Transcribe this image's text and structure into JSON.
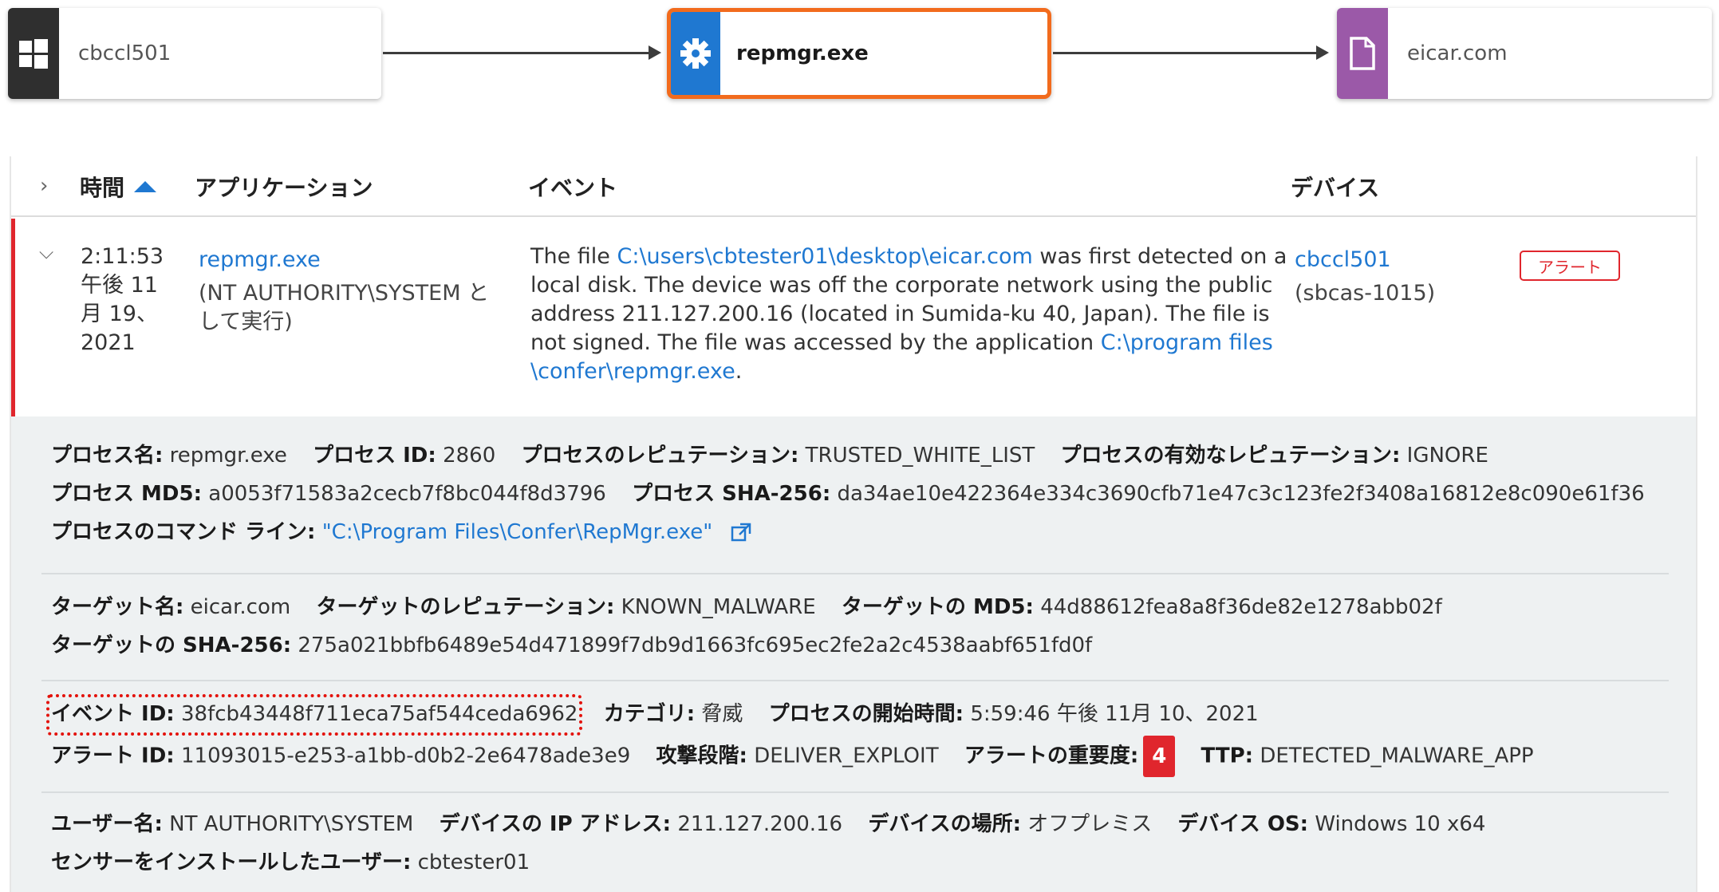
{
  "process_tree": {
    "host": {
      "label": "cbccl501",
      "icon": "windows-icon",
      "color": "#2f2f2f"
    },
    "process": {
      "label": "repmgr.exe",
      "icon": "gear-icon",
      "color": "#1f78d1",
      "selected_border": "#f26b1d"
    },
    "target": {
      "label": "eicar.com",
      "icon": "file-icon",
      "color": "#9b59a8"
    }
  },
  "table": {
    "headers": {
      "time": "時間",
      "application": "アプリケーション",
      "event": "イベント",
      "device": "デバイス"
    },
    "row": {
      "time_lines": [
        "2:11:53",
        "午後 11",
        "月 19、",
        "2021"
      ],
      "app_name": "repmgr.exe",
      "app_context": "(NT AUTHORITY\\SYSTEM として実行)",
      "event_text_1": "The file ",
      "event_link_1": "C:\\users\\cbtester01\\desktop\\eicar.com",
      "event_text_2": " was first detected on a local disk. The device was off the corporate network using the public address 211.127.200.16 (located in Sumida-ku 40, Japan). The file is not signed. The file was accessed by the application  ",
      "event_link_2": "C:\\program files\\confer\\repmgr.exe",
      "event_text_3": ".",
      "device_name": "cbccl501",
      "device_id": "(sbcas-1015)",
      "alert_tag": "アラート",
      "alert_color": "#e0262d"
    }
  },
  "details": {
    "process_name_label": "プロセス名:",
    "process_name": "repmgr.exe",
    "process_id_label": "プロセス ID:",
    "process_id": "2860",
    "process_rep_label": "プロセスのレピュテーション:",
    "process_rep": "TRUSTED_WHITE_LIST",
    "process_eff_rep_label": "プロセスの有効なレピュテーション:",
    "process_eff_rep": "IGNORE",
    "process_md5_label": "プロセス MD5:",
    "process_md5": "a0053f71583a2cecb7f8bc044f8d3796",
    "process_sha_label": "プロセス SHA-256:",
    "process_sha": "da34ae10e422364e334c3690cfb71e47c3c123fe2f3408a16812e8c090e61f36",
    "cmdline_label": "プロセスのコマンド ライン:",
    "cmdline": "\"C:\\Program Files\\Confer\\RepMgr.exe\"",
    "target_name_label": "ターゲット名:",
    "target_name": "eicar.com",
    "target_rep_label": "ターゲットのレピュテーション:",
    "target_rep": "KNOWN_MALWARE",
    "target_md5_label": "ターゲットの MD5:",
    "target_md5": "44d88612fea8a8f36de82e1278abb02f",
    "target_sha_label": "ターゲットの SHA-256:",
    "target_sha": "275a021bbfb6489e54d471899f7db9d1663fc695ec2fe2a2c4538aabf651fd0f",
    "event_id_label": "イベント ID:",
    "event_id": "38fcb43448f711eca75af544ceda6962",
    "category_label": "カテゴリ:",
    "category": "脅威",
    "proc_start_label": "プロセスの開始時間:",
    "proc_start": "5:59:46 午後 11月 10、2021",
    "alert_id_label": "アラート ID:",
    "alert_id": "11093015-e253-a1bb-d0b2-2e6478ade3e9",
    "attack_stage_label": "攻撃段階:",
    "attack_stage": "DELIVER_EXPLOIT",
    "severity_label": "アラートの重要度:",
    "severity": "4",
    "ttp_label": "TTP:",
    "ttp": "DETECTED_MALWARE_APP",
    "user_label": "ユーザー名:",
    "user": "NT AUTHORITY\\SYSTEM",
    "device_ip_label": "デバイスの IP アドレス:",
    "device_ip": "211.127.200.16",
    "device_loc_label": "デバイスの場所:",
    "device_loc": "オフプレミス",
    "device_os_label": "デバイス OS:",
    "device_os": "Windows 10 x64",
    "sensor_user_label": "センサーをインストールしたユーザー:",
    "sensor_user": "cbtester01"
  }
}
